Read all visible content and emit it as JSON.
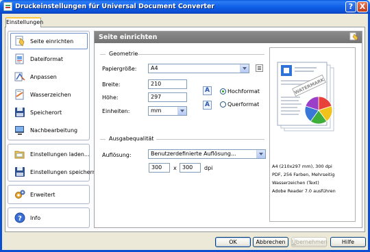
{
  "window": {
    "title": "Druckeinstellungen für Universal Document Converter",
    "help_btn": "?",
    "close_btn": "X"
  },
  "tab": {
    "label": "Einstellungen"
  },
  "sidebar": {
    "items": [
      {
        "label": "Seite einrichten",
        "icon": "page-setup-icon",
        "active": true
      },
      {
        "label": "Dateiformat",
        "icon": "file-format-icon"
      },
      {
        "label": "Anpassen",
        "icon": "adjust-icon"
      },
      {
        "label": "Wasserzeichen",
        "icon": "watermark-icon"
      },
      {
        "label": "Speicherort",
        "icon": "save-location-icon"
      },
      {
        "label": "Nachbearbeitung",
        "icon": "post-processing-icon"
      }
    ],
    "profile_items": [
      {
        "label": "Einstellungen laden...",
        "icon": "load-settings-icon"
      },
      {
        "label": "Einstellungen speichern...",
        "icon": "save-settings-icon"
      }
    ],
    "advanced": {
      "label": "Erweitert",
      "icon": "advanced-icon"
    },
    "info": {
      "label": "Info",
      "icon": "info-icon"
    }
  },
  "panel": {
    "header": "Seite einrichten",
    "geometry": {
      "title": "Geometrie",
      "paper_size_label": "Papiergröße:",
      "paper_size_value": "A4",
      "width_label": "Breite:",
      "width_value": "210",
      "height_label": "Höhe:",
      "height_value": "297",
      "units_label": "Einheiten:",
      "units_value": "mm",
      "portrait_label": "Hochformat",
      "landscape_label": "Querformat",
      "orientation_selected": "Hochformat",
      "orient_glyph": "A"
    },
    "quality": {
      "title": "Ausgabequalität",
      "resolution_label": "Auflösung:",
      "resolution_value": "Benutzerdefinierte Auflösung...",
      "dpi_x": "300",
      "dpi_sep": "x",
      "dpi_y": "300",
      "dpi_unit": "dpi"
    },
    "preview": {
      "watermark": "WATERMARK",
      "lines": [
        "A4 (210x297 mm), 300 dpi",
        "PDF, 256 Farben, Mehrseitig",
        "Wasserzeichen (Text)",
        "Adobe Reader 7.0 ausführen"
      ],
      "pie_colors": [
        "#E8403A",
        "#F2C21C",
        "#3FAE3A",
        "#3A78D8",
        "#9B3FC8"
      ]
    }
  },
  "buttons": {
    "ok": "OK",
    "cancel": "Abbrechen",
    "apply_underlined": "Ü",
    "apply_rest": "bernehmen",
    "help": "Hilfe"
  }
}
